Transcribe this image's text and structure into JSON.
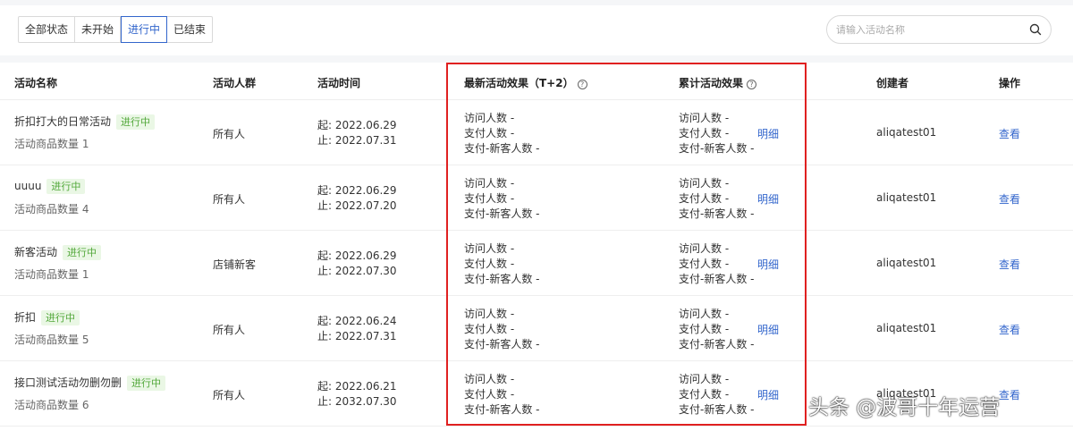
{
  "filter": {
    "tabs": [
      {
        "label": "全部状态"
      },
      {
        "label": "未开始"
      },
      {
        "label": "进行中"
      },
      {
        "label": "已结束"
      }
    ],
    "active": "进行中",
    "search_placeholder": "请输入活动名称",
    "search_value": ""
  },
  "columns": {
    "name": "活动名称",
    "audience": "活动人群",
    "time": "活动时间",
    "latest": "最新活动效果（T+2）",
    "cumulative": "累计活动效果",
    "creator": "创建者",
    "action": "操作"
  },
  "metric_labels": {
    "visitors": "访问人数 -",
    "payers": "支付人数 -",
    "new_payers": "支付-新客人数 -"
  },
  "detail_label": "明细",
  "view_label": "查看",
  "rows": [
    {
      "name": "折扣打大的日常活动",
      "status": "进行中",
      "count": "活动商品数量 1",
      "audience": "所有人",
      "start": "起: 2022.06.29",
      "end": "止: 2022.07.31",
      "creator": "aliqatest01"
    },
    {
      "name": "uuuu",
      "status": "进行中",
      "count": "活动商品数量 4",
      "audience": "所有人",
      "start": "起: 2022.06.29",
      "end": "止: 2022.07.20",
      "creator": "aliqatest01"
    },
    {
      "name": "新客活动",
      "status": "进行中",
      "count": "活动商品数量 1",
      "audience": "店铺新客",
      "start": "起: 2022.06.29",
      "end": "止: 2022.07.30",
      "creator": "aliqatest01"
    },
    {
      "name": "折扣",
      "status": "进行中",
      "count": "活动商品数量 5",
      "audience": "所有人",
      "start": "起: 2022.06.24",
      "end": "止: 2022.07.31",
      "creator": "aliqatest01"
    },
    {
      "name": "接口测试活动勿删勿删",
      "status": "进行中",
      "count": "活动商品数量 6",
      "audience": "所有人",
      "start": "起: 2022.06.21",
      "end": "止: 2032.07.30",
      "creator": "aliqatest01"
    }
  ],
  "watermark": "头条 @波哥十年运营",
  "colors": {
    "accent": "#3366cc",
    "highlight": "#e02020",
    "tag_bg": "#eaf7e5",
    "tag_text": "#52a83a"
  }
}
